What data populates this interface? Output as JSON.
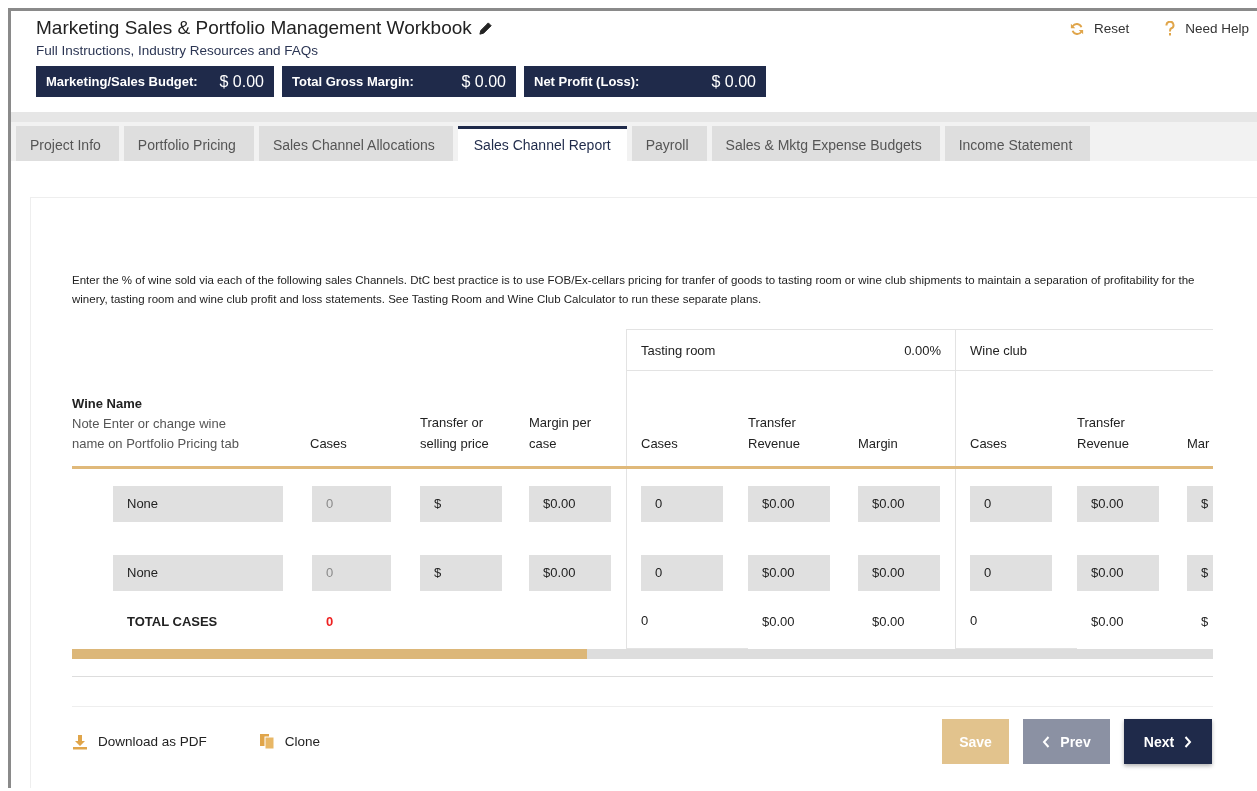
{
  "header": {
    "title": "Marketing Sales & Portfolio Management Workbook",
    "subtitle": "Full Instructions, Industry Resources and FAQs",
    "actions": [
      {
        "label": "Reset",
        "kind": "reset"
      },
      {
        "label": "Need Help",
        "kind": "help"
      }
    ]
  },
  "summary": [
    {
      "label": "Marketing/Sales Budget:",
      "value": "$ 0.00"
    },
    {
      "label": "Total Gross Margin:",
      "value": "$ 0.00"
    },
    {
      "label": "Net Profit (Loss):",
      "value": "$ 0.00"
    }
  ],
  "tabs": [
    {
      "label": "Project Info",
      "selected": false
    },
    {
      "label": "Portfolio Pricing",
      "selected": false
    },
    {
      "label": "Sales Channel Allocations",
      "selected": false
    },
    {
      "label": "Sales Channel Report",
      "selected": true
    },
    {
      "label": "Payroll",
      "selected": false
    },
    {
      "label": "Sales & Mktg Expense Budgets",
      "selected": false
    },
    {
      "label": "Income Statement",
      "selected": false
    }
  ],
  "intro": "Enter the % of wine sold via each of the following sales Channels. DtC best practice is to use FOB/Ex-cellars pricing for tranfer of goods to tasting room or wine club shipments to maintain a separation of profitability for the winery, tasting room and wine club profit and loss statements. See Tasting Room and Wine Club Calculator to run these separate plans.",
  "table": {
    "wine_column": {
      "label": "Wine Name",
      "note": "Note Enter or change wine name on Portfolio Pricing tab"
    },
    "columns": [
      "Cases",
      "Transfer or selling price",
      "Margin per case"
    ],
    "groups": [
      {
        "name": "Tasting room",
        "percent": "0.00%",
        "columns": [
          "Cases",
          "Transfer Revenue",
          "Margin"
        ]
      },
      {
        "name": "Wine club",
        "columns": [
          "Cases",
          "Transfer Revenue",
          "Mar"
        ]
      }
    ],
    "rows": [
      {
        "name": "None",
        "cases": "0",
        "cases_disabled": true,
        "price": "$",
        "margin": "$0.00",
        "groups": [
          [
            "0",
            "$0.00",
            "$0.00"
          ],
          [
            "0",
            "$0.00",
            "$"
          ]
        ]
      },
      {
        "name": "None",
        "cases": "0",
        "cases_disabled": true,
        "price": "$",
        "margin": "$0.00",
        "groups": [
          [
            "0",
            "$0.00",
            "$0.00"
          ],
          [
            "0",
            "$0.00",
            "$"
          ]
        ]
      }
    ],
    "totals": {
      "label": "TOTAL CASES",
      "cases": "0",
      "alert": true,
      "groups": [
        [
          "0",
          "$0.00",
          "$0.00"
        ],
        [
          "0",
          "$0.00",
          "$"
        ]
      ]
    }
  },
  "footer": {
    "links": [
      {
        "label": "Download as PDF",
        "kind": "download"
      },
      {
        "label": "Clone",
        "kind": "clone"
      }
    ],
    "buttons": [
      {
        "label": "Save",
        "kind": "save",
        "disabled": true
      },
      {
        "label": "Prev",
        "kind": "prev",
        "disabled": false
      },
      {
        "label": "Next",
        "kind": "next",
        "disabled": false
      }
    ]
  }
}
